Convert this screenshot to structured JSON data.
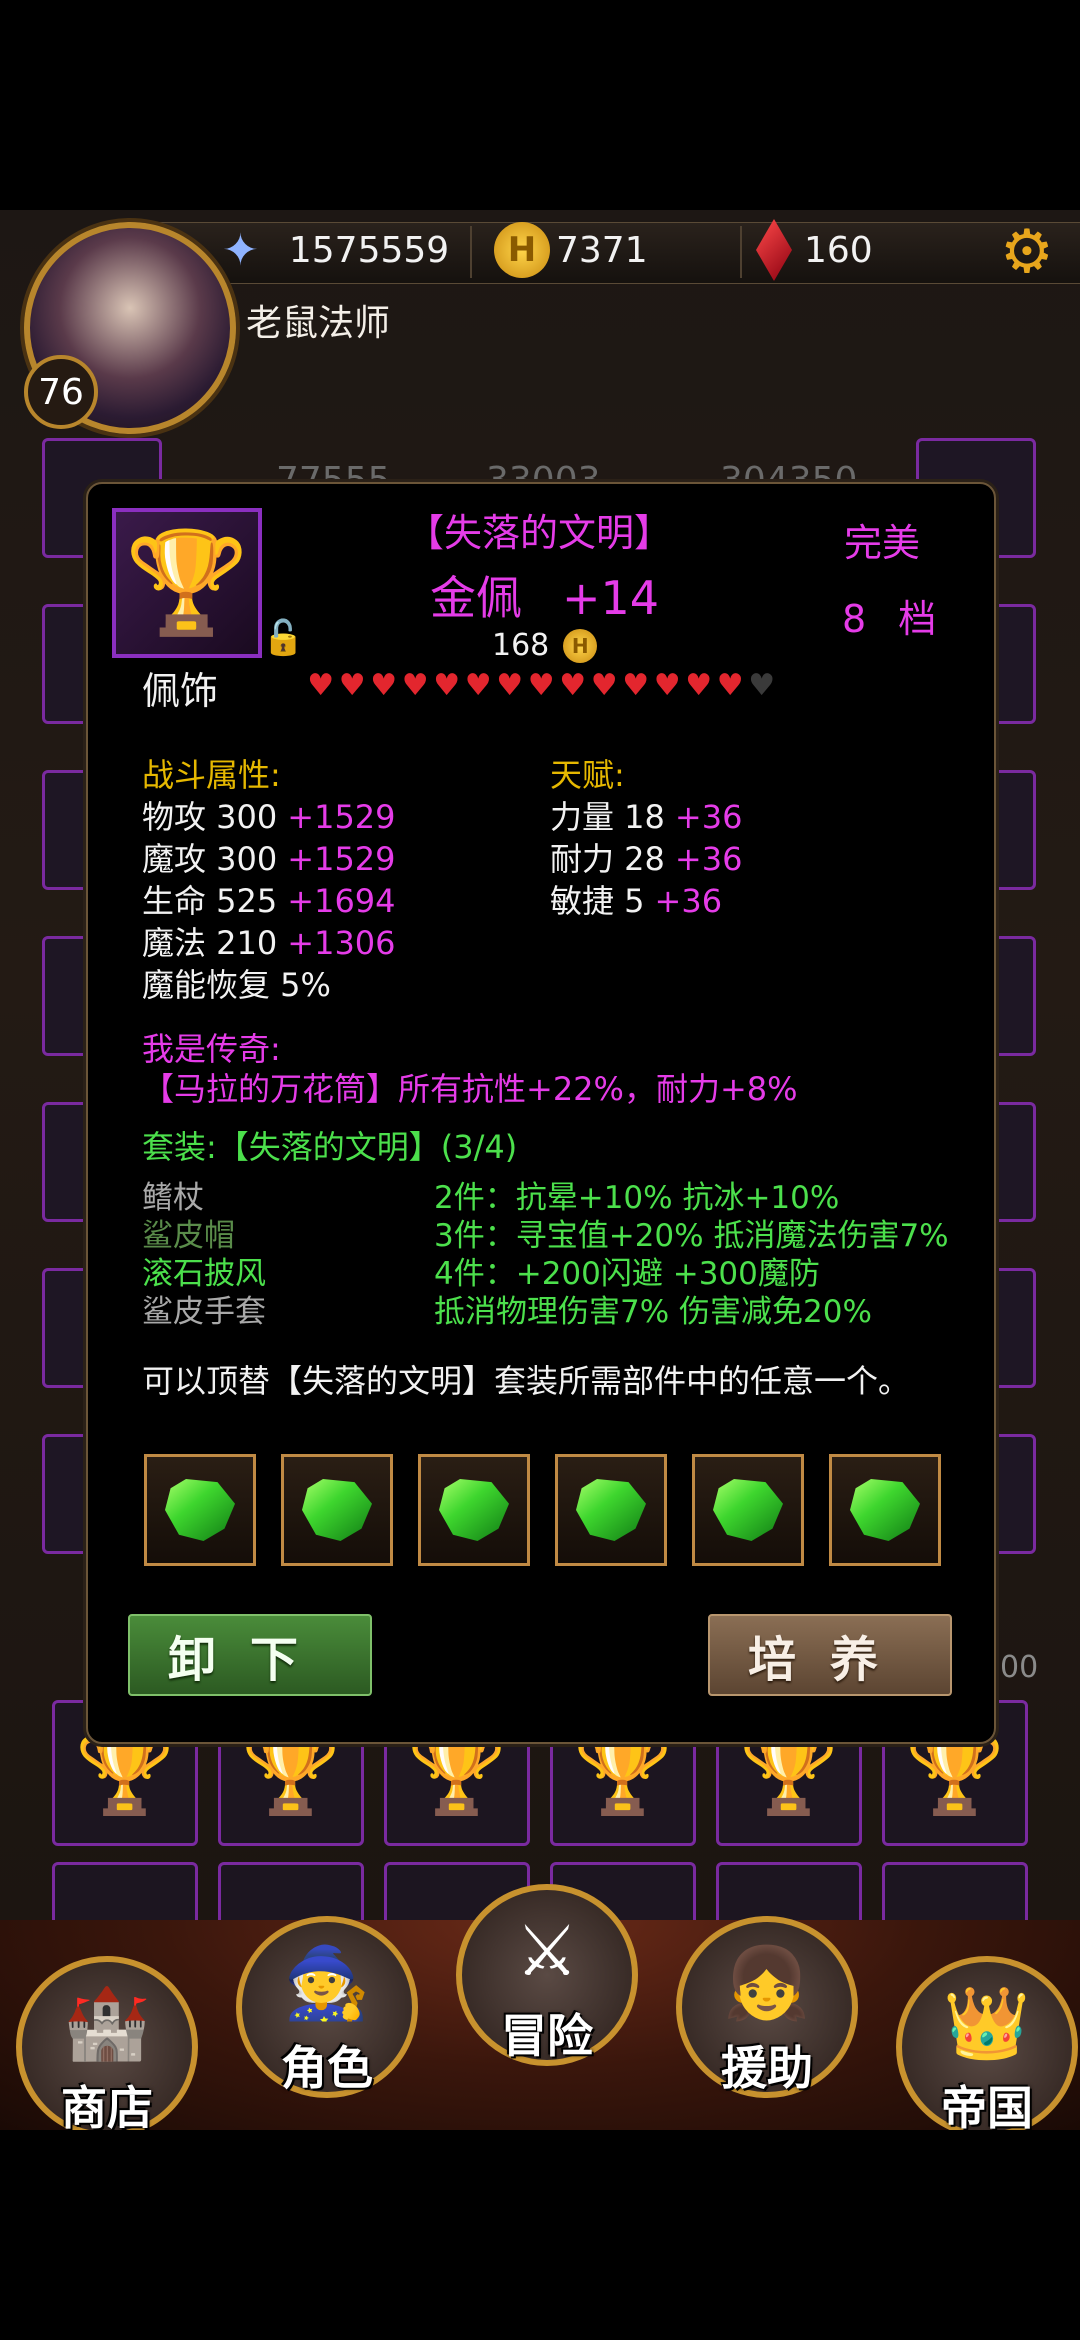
{
  "header": {
    "player_name": "老鼠法师",
    "level": "76",
    "power": "1575559",
    "gold": "7371",
    "gems": "160",
    "icons": [
      "magic-staff-icon",
      "gold-coin-icon",
      "red-crystal-icon",
      "gear-icon"
    ]
  },
  "background": {
    "stat_1": "77555",
    "stat_2": "33003",
    "stat_3": "304350",
    "right_value": "00"
  },
  "item": {
    "set_name": "【失落的文明】",
    "name": "金佩",
    "enhance": "+14",
    "quality": "完美",
    "tier": "8 档",
    "price": "168",
    "slot_type": "佩饰",
    "hearts_filled": 14,
    "hearts_total": 15,
    "icon": "gold-chalice-icon"
  },
  "combat": {
    "heading": "战斗属性:",
    "rows": [
      {
        "label": "物攻 300",
        "bonus": "+1529"
      },
      {
        "label": "魔攻 300",
        "bonus": "+1529"
      },
      {
        "label": "生命 525",
        "bonus": "+1694"
      },
      {
        "label": "魔法 210",
        "bonus": "+1306"
      },
      {
        "label": "魔能恢复 5%",
        "bonus": ""
      }
    ]
  },
  "talent": {
    "heading": "天赋:",
    "rows": [
      {
        "label": "力量 18",
        "bonus": "+36"
      },
      {
        "label": "耐力 28",
        "bonus": "+36"
      },
      {
        "label": "敏捷 5",
        "bonus": "+36"
      }
    ]
  },
  "legend": {
    "heading": "我是传奇:",
    "text": "【马拉的万花筒】所有抗性+22%，耐力+8%"
  },
  "set": {
    "heading": "套装:【失落的文明】(3/4)",
    "pieces": [
      {
        "name": "鳍杖",
        "state": "gray"
      },
      {
        "name": "鲨皮帽",
        "state": "dim-green"
      },
      {
        "name": "滚石披风",
        "state": "green"
      },
      {
        "name": "鲨皮手套",
        "state": "gray"
      }
    ],
    "bonuses": [
      "2件：抗晕+10% 抗冰+10%",
      "3件：寻宝值+20% 抵消魔法伤害7%",
      "4件：+200闪避 +300魔防",
      "抵消物理伤害7% 伤害减免20%"
    ],
    "note": "可以顶替【失落的文明】套装所需部件中的任意一个。"
  },
  "gem_slots": [
    "green-gem-icon",
    "green-gem-icon",
    "green-gem-icon",
    "green-gem-icon",
    "green-gem-icon",
    "green-gem-icon"
  ],
  "buttons": {
    "unequip": "卸下",
    "train": "培养"
  },
  "nav": {
    "shop": "商店",
    "character": "角色",
    "adventure": "冒险",
    "assist": "援助",
    "empire": "帝国"
  }
}
